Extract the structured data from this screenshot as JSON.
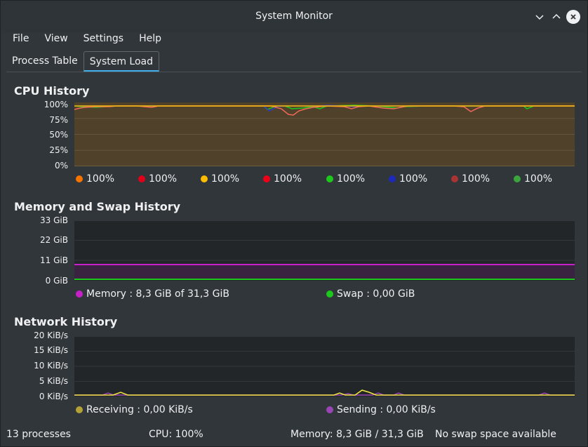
{
  "window": {
    "title": "System Monitor"
  },
  "menu": [
    "File",
    "View",
    "Settings",
    "Help"
  ],
  "tabs": [
    {
      "label": "Process Table",
      "active": false
    },
    {
      "label": "System Load",
      "active": true
    }
  ],
  "cpu": {
    "title": "CPU History",
    "yticks": [
      "100%",
      "75%",
      "50%",
      "25%",
      "0%"
    ],
    "legend": [
      {
        "label": "100%",
        "color": "#f67400"
      },
      {
        "label": "100%",
        "color": "#e0001a"
      },
      {
        "label": "100%",
        "color": "#fdbc00"
      },
      {
        "label": "100%",
        "color": "#ee0018"
      },
      {
        "label": "100%",
        "color": "#1cc81c"
      },
      {
        "label": "100%",
        "color": "#1d2ab9"
      },
      {
        "label": "100%",
        "color": "#a83234"
      },
      {
        "label": "100%",
        "color": "#3ba43b"
      }
    ]
  },
  "memory": {
    "title": "Memory and Swap History",
    "yticks": [
      "33 GiB",
      "22 GiB",
      "11 GiB",
      "0 GiB"
    ],
    "legend": [
      {
        "label": "Memory : 8,3 GiB of 31,3 GiB",
        "color": "#c820c8"
      },
      {
        "label": "Swap : 0,00 GiB",
        "color": "#1cc81c"
      }
    ]
  },
  "network": {
    "title": "Network History",
    "yticks": [
      "20 KiB/s",
      "15 KiB/s",
      "10 KiB/s",
      "5 KiB/s",
      "0 KiB/s"
    ],
    "legend": [
      {
        "label": "Receiving : 0,00 KiB/s",
        "color": "#b5a236"
      },
      {
        "label": "Sending : 0,00 KiB/s",
        "color": "#9a45b5"
      }
    ]
  },
  "status": {
    "processes": "13 processes",
    "cpu": "CPU: 100%",
    "memory": "Memory: 8,3 GiB / 31,3 GiB",
    "swap": "No swap space available"
  },
  "chart_data": [
    {
      "type": "line",
      "title": "CPU History",
      "ylim": [
        0,
        100
      ],
      "yunit": "%",
      "grid": true,
      "series_count": 8,
      "approx_values": "all cores near 100% with brief dips to ~85%"
    },
    {
      "type": "line",
      "title": "Memory and Swap History",
      "ylim": [
        0,
        33
      ],
      "yunit": "GiB",
      "grid": true,
      "series": [
        {
          "name": "Memory",
          "values": [
            8.3,
            8.3
          ]
        },
        {
          "name": "Swap",
          "values": [
            0,
            0
          ]
        }
      ]
    },
    {
      "type": "line",
      "title": "Network History",
      "ylim": [
        0,
        20
      ],
      "yunit": "KiB/s",
      "grid": true,
      "series": [
        {
          "name": "Receiving",
          "values": [
            0,
            0
          ]
        },
        {
          "name": "Sending",
          "values": [
            0,
            0
          ]
        }
      ]
    }
  ]
}
